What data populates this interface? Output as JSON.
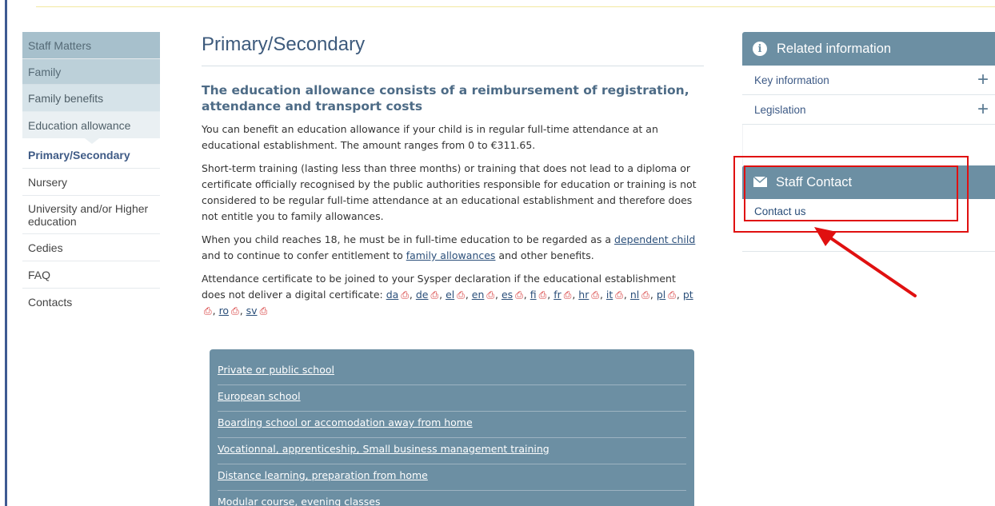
{
  "sidebar": {
    "items": [
      {
        "label": "Staff Matters"
      },
      {
        "label": "Family"
      },
      {
        "label": "Family benefits"
      },
      {
        "label": "Education allowance"
      },
      {
        "label": "Primary/Secondary"
      },
      {
        "label": "Nursery"
      },
      {
        "label": "University and/or Higher education"
      },
      {
        "label": "Cedies"
      },
      {
        "label": "FAQ"
      },
      {
        "label": "Contacts"
      }
    ]
  },
  "main": {
    "title": "Primary/Secondary",
    "subtitle": "The education allowance consists of a reimbursement of registration, attendance and transport costs",
    "p1": "You can benefit an education allowance if your child is in regular full-time attendance at an educational establishment. The amount ranges from 0 to €311.65.",
    "p2": "Short-term training (lasting less than three months) or training that does not lead to a diploma or certificate officially recognised by the public authorities responsible for education or training is not considered to be regular full-time attendance at an educational establishment and therefore does not entitle you to family allowances.",
    "p3": {
      "before": "When you child reaches 18, he must be in full-time education to be regarded as a ",
      "link1": "dependent child",
      "middle": " and to continue to confer entitlement to ",
      "link2": "family allowances",
      "after": " and other benefits."
    },
    "p4_text": "Attendance certificate to be joined to your Sysper declaration if the educational establishment does not deliver a digital certificate: ",
    "languages": [
      "da",
      "de",
      "el",
      "en",
      "es",
      "fi",
      "fr",
      "hr",
      "it",
      "nl",
      "pl",
      "pt",
      "ro",
      "sv"
    ],
    "links": [
      "Private or public school",
      "European school",
      "Boarding school or accomodation away from home",
      "Vocationnal, apprenticeship, Small business management training",
      "Distance learning, preparation from home",
      "Modular course, evening classes"
    ]
  },
  "related": {
    "title": "Related information",
    "items": [
      "Key information",
      "Legislation"
    ]
  },
  "contact": {
    "title": "Staff Contact",
    "link": "Contact us"
  },
  "colors": {
    "accent": "#6c8fa3",
    "annotation": "#e01010",
    "pdf_icon": "#d32a2a"
  }
}
